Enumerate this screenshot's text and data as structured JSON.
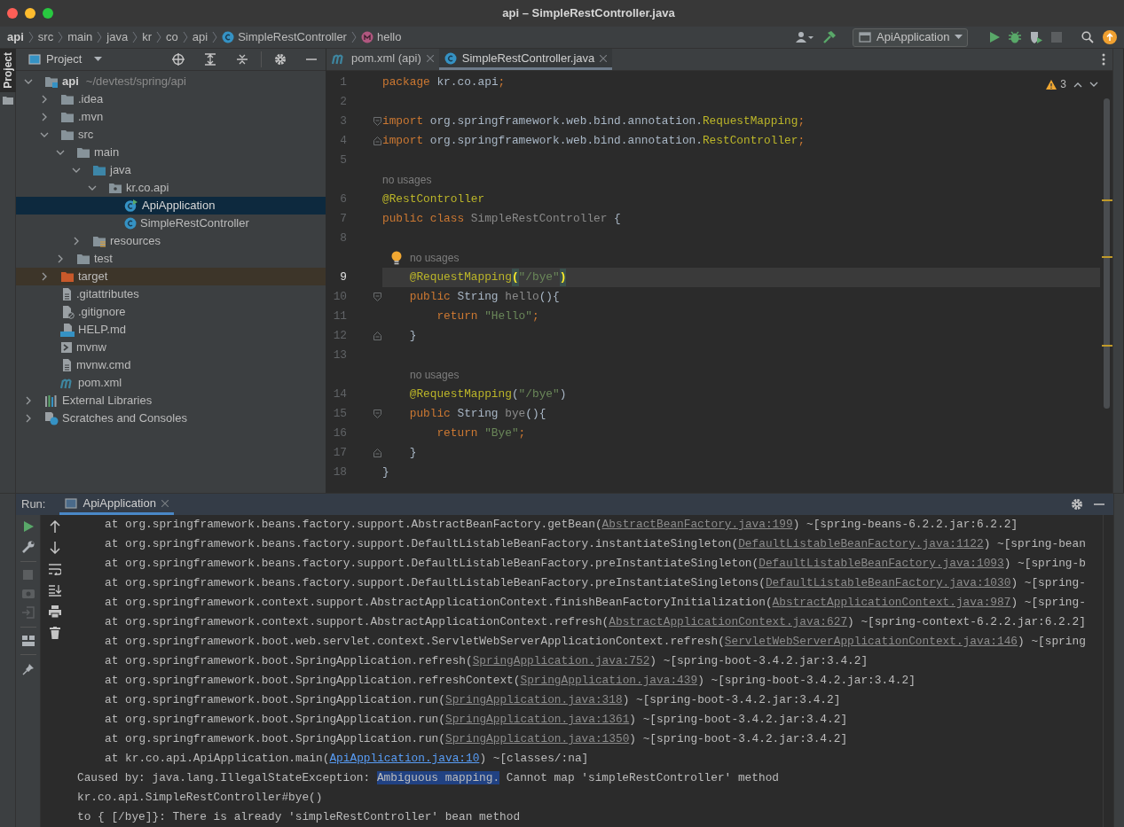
{
  "window": {
    "title": "api – SimpleRestController.java"
  },
  "breadcrumbs": [
    {
      "label": "api",
      "kind": "project"
    },
    {
      "label": "src",
      "kind": "dir"
    },
    {
      "label": "main",
      "kind": "dir"
    },
    {
      "label": "java",
      "kind": "dir"
    },
    {
      "label": "kr",
      "kind": "dir"
    },
    {
      "label": "co",
      "kind": "dir"
    },
    {
      "label": "api",
      "kind": "dir"
    },
    {
      "label": "SimpleRestController",
      "kind": "class"
    },
    {
      "label": "hello",
      "kind": "method"
    }
  ],
  "toolbar": {
    "run_config": "ApiApplication"
  },
  "side_tabs": [
    {
      "label": "Project",
      "selected": true
    }
  ],
  "project": {
    "title": "Project",
    "tree": [
      {
        "label": "api",
        "path": "~/devtest/spring/api",
        "kind": "module",
        "expanded": true,
        "selected": false,
        "children": [
          {
            "label": ".idea",
            "kind": "folder",
            "expanded": false,
            "selected": false
          },
          {
            "label": ".mvn",
            "kind": "folder",
            "expanded": false,
            "selected": false
          },
          {
            "label": "src",
            "kind": "folder",
            "expanded": true,
            "selected": false,
            "children": [
              {
                "label": "main",
                "kind": "folder",
                "expanded": true,
                "selected": false,
                "children": [
                  {
                    "label": "java",
                    "kind": "source",
                    "expanded": true,
                    "selected": false,
                    "children": [
                      {
                        "label": "kr.co.api",
                        "kind": "package",
                        "expanded": true,
                        "selected": false,
                        "children": [
                          {
                            "label": "ApiApplication",
                            "kind": "application",
                            "selected": true
                          },
                          {
                            "label": "SimpleRestController",
                            "kind": "class",
                            "selected": false
                          }
                        ]
                      }
                    ]
                  },
                  {
                    "label": "resources",
                    "kind": "resources",
                    "expanded": false,
                    "selected": false
                  }
                ]
              },
              {
                "label": "test",
                "kind": "folder",
                "expanded": false,
                "selected": false
              }
            ]
          },
          {
            "label": "target",
            "kind": "excluded",
            "expanded": false,
            "selected": false
          },
          {
            "label": ".gitattributes",
            "kind": "file",
            "selected": false
          },
          {
            "label": ".gitignore",
            "kind": "ignore",
            "selected": false
          },
          {
            "label": "HELP.md",
            "kind": "markdown",
            "selected": false
          },
          {
            "label": "mvnw",
            "kind": "script",
            "selected": false
          },
          {
            "label": "mvnw.cmd",
            "kind": "file",
            "selected": false
          },
          {
            "label": "pom.xml",
            "kind": "maven",
            "selected": false
          }
        ]
      },
      {
        "label": "External Libraries",
        "kind": "libraries",
        "expanded": false,
        "selected": false
      },
      {
        "label": "Scratches and Consoles",
        "kind": "scratches",
        "expanded": false,
        "selected": false
      }
    ]
  },
  "editor": {
    "tabs": [
      {
        "label": "pom.xml (api)",
        "kind": "maven",
        "selected": false
      },
      {
        "label": "SimpleRestController.java",
        "kind": "class",
        "selected": true
      }
    ],
    "warnings": "3",
    "lines": [
      {
        "kind": "code",
        "number": "1",
        "current": false,
        "tokens": [
          {
            "text": "package",
            "kind": "keyword"
          },
          {
            "text": " kr.co.api",
            "kind": "plain"
          },
          {
            "text": ";",
            "kind": "keyword"
          }
        ]
      },
      {
        "kind": "code",
        "number": "2",
        "current": false
      },
      {
        "kind": "code",
        "number": "3",
        "current": false,
        "fold_start": true,
        "tokens": [
          {
            "text": "import",
            "kind": "keyword"
          },
          {
            "text": " org.springframework.web.bind.annotation.",
            "kind": "plain"
          },
          {
            "text": "RequestMapping",
            "kind": "annotation"
          },
          {
            "text": ";",
            "kind": "keyword"
          }
        ]
      },
      {
        "kind": "code",
        "number": "4",
        "current": false,
        "fold_end": true,
        "tokens": [
          {
            "text": "import",
            "kind": "keyword"
          },
          {
            "text": " org.springframework.web.bind.annotation.",
            "kind": "plain"
          },
          {
            "text": "RestController",
            "kind": "annotation"
          },
          {
            "text": ";",
            "kind": "keyword"
          }
        ]
      },
      {
        "kind": "code",
        "number": "5",
        "current": false
      },
      {
        "kind": "hint",
        "text": "no usages",
        "nested": false,
        "bulb": false
      },
      {
        "kind": "code",
        "number": "6",
        "current": false,
        "tokens": [
          {
            "text": "@RestController",
            "kind": "annotation"
          }
        ]
      },
      {
        "kind": "code",
        "number": "7",
        "current": false,
        "tokens": [
          {
            "text": "public class",
            "kind": "keyword"
          },
          {
            "text": " SimpleRestController",
            "kind": "unused"
          },
          {
            "text": " {",
            "kind": "plain"
          }
        ]
      },
      {
        "kind": "code",
        "number": "8",
        "current": false
      },
      {
        "kind": "hint",
        "text": "no usages",
        "nested": true,
        "bulb": true
      },
      {
        "kind": "code",
        "number": "9",
        "current": true,
        "tokens": [
          {
            "text": "    @RequestMapping",
            "kind": "annotation"
          },
          {
            "text": "(",
            "kind": "brace-match"
          },
          {
            "text": "\"/bye\"",
            "kind": "string"
          },
          {
            "text": ")",
            "kind": "brace-match"
          }
        ]
      },
      {
        "kind": "code",
        "number": "10",
        "current": false,
        "fold_start": true,
        "tokens": [
          {
            "text": "    public",
            "kind": "keyword"
          },
          {
            "text": " String ",
            "kind": "plain"
          },
          {
            "text": "hello",
            "kind": "unused"
          },
          {
            "text": "(){",
            "kind": "plain"
          }
        ]
      },
      {
        "kind": "code",
        "number": "11",
        "current": false,
        "tokens": [
          {
            "text": "        return",
            "kind": "keyword"
          },
          {
            "text": " \"Hello\"",
            "kind": "string"
          },
          {
            "text": ";",
            "kind": "keyword"
          }
        ]
      },
      {
        "kind": "code",
        "number": "12",
        "current": false,
        "fold_end": true,
        "tokens": [
          {
            "text": "    }",
            "kind": "plain"
          }
        ]
      },
      {
        "kind": "code",
        "number": "13",
        "current": false
      },
      {
        "kind": "hint",
        "text": "no usages",
        "nested": true,
        "bulb": false
      },
      {
        "kind": "code",
        "number": "14",
        "current": false,
        "tokens": [
          {
            "text": "    @RequestMapping",
            "kind": "annotation"
          },
          {
            "text": "(",
            "kind": "plain"
          },
          {
            "text": "\"/bye\"",
            "kind": "string"
          },
          {
            "text": ")",
            "kind": "plain"
          }
        ]
      },
      {
        "kind": "code",
        "number": "15",
        "current": false,
        "fold_start": true,
        "tokens": [
          {
            "text": "    public",
            "kind": "keyword"
          },
          {
            "text": " String ",
            "kind": "plain"
          },
          {
            "text": "bye",
            "kind": "unused"
          },
          {
            "text": "(){",
            "kind": "plain"
          }
        ]
      },
      {
        "kind": "code",
        "number": "16",
        "current": false,
        "tokens": [
          {
            "text": "        return",
            "kind": "keyword"
          },
          {
            "text": " \"Bye\"",
            "kind": "string"
          },
          {
            "text": ";",
            "kind": "keyword"
          }
        ]
      },
      {
        "kind": "code",
        "number": "17",
        "current": false,
        "fold_end": true,
        "tokens": [
          {
            "text": "    }",
            "kind": "plain"
          }
        ]
      },
      {
        "kind": "code",
        "number": "18",
        "current": false,
        "tokens": [
          {
            "text": "}",
            "kind": "plain"
          }
        ]
      }
    ]
  },
  "run": {
    "label": "Run:",
    "tabs": [
      {
        "label": "ApiApplication",
        "selected": true
      }
    ],
    "console": [
      {
        "indented": true,
        "parts": [
          {
            "text": "at org.springframework.beans.factory.support.AbstractBeanFactory.getBean(",
            "kind": "plain"
          },
          {
            "text": "AbstractBeanFactory.java:199",
            "kind": "link"
          },
          {
            "text": ") ~[spring-beans-6.2.2.jar:6.2.2]",
            "kind": "plain"
          }
        ]
      },
      {
        "indented": true,
        "parts": [
          {
            "text": "at org.springframework.beans.factory.support.DefaultListableBeanFactory.instantiateSingleton(",
            "kind": "plain"
          },
          {
            "text": "DefaultListableBeanFactory.java:1122",
            "kind": "link"
          },
          {
            "text": ") ~[spring-bean",
            "kind": "plain"
          }
        ]
      },
      {
        "indented": true,
        "parts": [
          {
            "text": "at org.springframework.beans.factory.support.DefaultListableBeanFactory.preInstantiateSingleton(",
            "kind": "plain"
          },
          {
            "text": "DefaultListableBeanFactory.java:1093",
            "kind": "link"
          },
          {
            "text": ") ~[spring-b",
            "kind": "plain"
          }
        ]
      },
      {
        "indented": true,
        "parts": [
          {
            "text": "at org.springframework.beans.factory.support.DefaultListableBeanFactory.preInstantiateSingletons(",
            "kind": "plain"
          },
          {
            "text": "DefaultListableBeanFactory.java:1030",
            "kind": "link"
          },
          {
            "text": ") ~[spring-",
            "kind": "plain"
          }
        ]
      },
      {
        "indented": true,
        "parts": [
          {
            "text": "at org.springframework.context.support.AbstractApplicationContext.finishBeanFactoryInitialization(",
            "kind": "plain"
          },
          {
            "text": "AbstractApplicationContext.java:987",
            "kind": "link"
          },
          {
            "text": ") ~[spring-",
            "kind": "plain"
          }
        ]
      },
      {
        "indented": true,
        "parts": [
          {
            "text": "at org.springframework.context.support.AbstractApplicationContext.refresh(",
            "kind": "plain"
          },
          {
            "text": "AbstractApplicationContext.java:627",
            "kind": "link"
          },
          {
            "text": ") ~[spring-context-6.2.2.jar:6.2.2]",
            "kind": "plain"
          }
        ]
      },
      {
        "indented": true,
        "parts": [
          {
            "text": "at org.springframework.boot.web.servlet.context.ServletWebServerApplicationContext.refresh(",
            "kind": "plain"
          },
          {
            "text": "ServletWebServerApplicationContext.java:146",
            "kind": "link"
          },
          {
            "text": ") ~[spring",
            "kind": "plain"
          }
        ]
      },
      {
        "indented": true,
        "parts": [
          {
            "text": "at org.springframework.boot.SpringApplication.refresh(",
            "kind": "plain"
          },
          {
            "text": "SpringApplication.java:752",
            "kind": "link"
          },
          {
            "text": ") ~[spring-boot-3.4.2.jar:3.4.2]",
            "kind": "plain"
          }
        ]
      },
      {
        "indented": true,
        "parts": [
          {
            "text": "at org.springframework.boot.SpringApplication.refreshContext(",
            "kind": "plain"
          },
          {
            "text": "SpringApplication.java:439",
            "kind": "link"
          },
          {
            "text": ") ~[spring-boot-3.4.2.jar:3.4.2]",
            "kind": "plain"
          }
        ]
      },
      {
        "indented": true,
        "parts": [
          {
            "text": "at org.springframework.boot.SpringApplication.run(",
            "kind": "plain"
          },
          {
            "text": "SpringApplication.java:318",
            "kind": "link"
          },
          {
            "text": ") ~[spring-boot-3.4.2.jar:3.4.2]",
            "kind": "plain"
          }
        ]
      },
      {
        "indented": true,
        "parts": [
          {
            "text": "at org.springframework.boot.SpringApplication.run(",
            "kind": "plain"
          },
          {
            "text": "SpringApplication.java:1361",
            "kind": "link"
          },
          {
            "text": ") ~[spring-boot-3.4.2.jar:3.4.2]",
            "kind": "plain"
          }
        ]
      },
      {
        "indented": true,
        "parts": [
          {
            "text": "at org.springframework.boot.SpringApplication.run(",
            "kind": "plain"
          },
          {
            "text": "SpringApplication.java:1350",
            "kind": "link"
          },
          {
            "text": ") ~[spring-boot-3.4.2.jar:3.4.2]",
            "kind": "plain"
          }
        ]
      },
      {
        "indented": true,
        "parts": [
          {
            "text": "at kr.co.api.ApiApplication.main(",
            "kind": "plain"
          },
          {
            "text": "ApiApplication.java:10",
            "kind": "user-link"
          },
          {
            "text": ") ~[classes/:na]",
            "kind": "plain"
          }
        ]
      },
      {
        "indented": false,
        "parts": [
          {
            "text": "Caused by: java.lang.IllegalStateException: ",
            "kind": "plain"
          },
          {
            "text": "Ambiguous mapping.",
            "kind": "selection"
          },
          {
            "text": " Cannot map 'simpleRestController' method",
            "kind": "plain"
          }
        ]
      },
      {
        "indented": false,
        "parts": [
          {
            "text": "kr.co.api.SimpleRestController#bye()",
            "kind": "plain"
          }
        ]
      },
      {
        "indented": false,
        "parts": [
          {
            "text": "to { [/bye]}: There is already 'simpleRestController' bean method",
            "kind": "plain"
          }
        ]
      }
    ]
  }
}
